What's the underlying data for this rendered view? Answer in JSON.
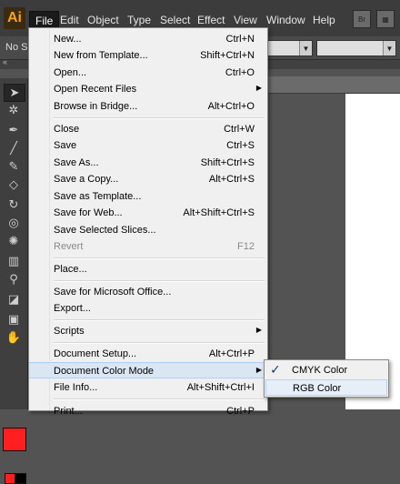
{
  "app": {
    "logo": "Ai"
  },
  "menubar": {
    "items": [
      "File",
      "Edit",
      "Object",
      "Type",
      "Select",
      "Effect",
      "View",
      "Window",
      "Help"
    ],
    "bridge_icon": "Br"
  },
  "controlbar": {
    "selection_label": "No Se"
  },
  "file_menu": {
    "items": [
      {
        "label": "New...",
        "shortcut": "Ctrl+N"
      },
      {
        "label": "New from Template...",
        "shortcut": "Shift+Ctrl+N"
      },
      {
        "label": "Open...",
        "shortcut": "Ctrl+O"
      },
      {
        "label": "Open Recent Files",
        "shortcut": "",
        "submenu": true
      },
      {
        "label": "Browse in Bridge...",
        "shortcut": "Alt+Ctrl+O"
      },
      {
        "label": "Close",
        "shortcut": "Ctrl+W"
      },
      {
        "label": "Save",
        "shortcut": "Ctrl+S"
      },
      {
        "label": "Save As...",
        "shortcut": "Shift+Ctrl+S"
      },
      {
        "label": "Save a Copy...",
        "shortcut": "Alt+Ctrl+S"
      },
      {
        "label": "Save as Template...",
        "shortcut": ""
      },
      {
        "label": "Save for Web...",
        "shortcut": "Alt+Shift+Ctrl+S"
      },
      {
        "label": "Save Selected Slices...",
        "shortcut": ""
      },
      {
        "label": "Revert",
        "shortcut": "F12",
        "disabled": true
      },
      {
        "label": "Place...",
        "shortcut": ""
      },
      {
        "label": "Save for Microsoft Office...",
        "shortcut": ""
      },
      {
        "label": "Export...",
        "shortcut": ""
      },
      {
        "label": "Scripts",
        "shortcut": "",
        "submenu": true
      },
      {
        "label": "Document Setup...",
        "shortcut": "Alt+Ctrl+P"
      },
      {
        "label": "Document Color Mode",
        "shortcut": "",
        "submenu": true,
        "highlighted": true
      },
      {
        "label": "File Info...",
        "shortcut": "Alt+Shift+Ctrl+I"
      },
      {
        "label": "Print...",
        "shortcut": "Ctrl+P"
      }
    ]
  },
  "color_mode_submenu": {
    "items": [
      {
        "label": "CMYK Color",
        "checked": true
      },
      {
        "label": "RGB Color",
        "checked": false
      }
    ]
  },
  "colors": {
    "fill": "#ff1f1f",
    "menu_bg": "#f0f0f0",
    "highlight": "#dbe6f4",
    "logo": "#f7a21b"
  }
}
